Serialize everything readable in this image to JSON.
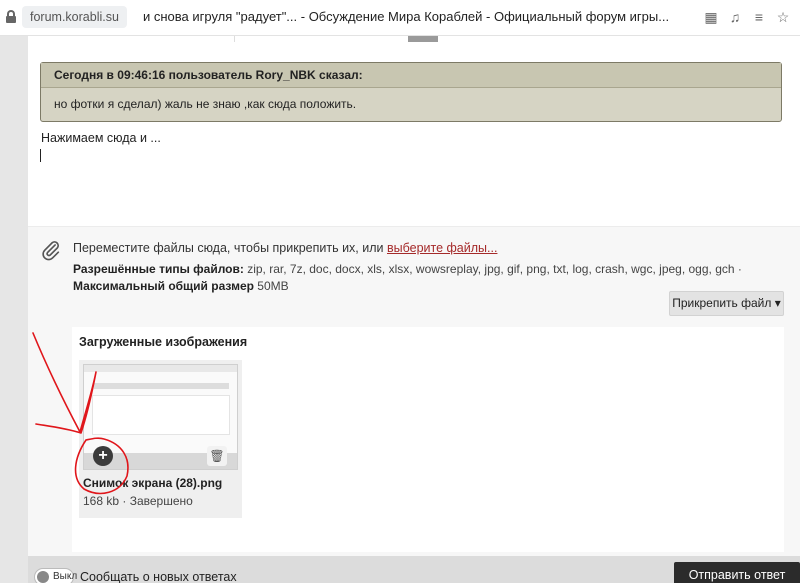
{
  "browser": {
    "url": "forum.korabli.su",
    "tab_title": "и снова игруля \"радует\"... - Обсуждение Мира Кораблей - Официальный форум игры..."
  },
  "quote": {
    "header": "Сегодня в 09:46:16 пользователь Rory_NBK сказал:",
    "body": "но фотки я сделал) жаль не знаю ,как сюда положить."
  },
  "editor": {
    "text": "Нажимаем сюда и ..."
  },
  "attachments": {
    "drop_text": "Переместите файлы сюда, чтобы прикрепить их, или ",
    "choose_link": "выберите файлы...",
    "types_label": "Разрешённые типы файлов:",
    "types_list": " zip, rar, 7z, doc, docx, xls, xlsx, wowsreplay, jpg, gif, png, txt, log, crash, wgc, jpeg, ogg, gch · ",
    "max_label": "Максимальный общий размер",
    "max_value": " 50MB",
    "attach_button": "Прикрепить файл ▾"
  },
  "uploaded": {
    "title": "Загруженные изображения",
    "files": [
      {
        "name": "Снимок экрана (28).png",
        "meta": "168 kb · Завершено"
      }
    ]
  },
  "footer": {
    "toggle_label": "Выкл",
    "notify_label": "Сообщать о новых ответах",
    "send_button": "Отправить ответ"
  },
  "colors": {
    "annotation": "#e0161b",
    "quote_border": "#7d7a66",
    "link": "#a52a2a",
    "send_button_bg": "#2b2b2b"
  }
}
